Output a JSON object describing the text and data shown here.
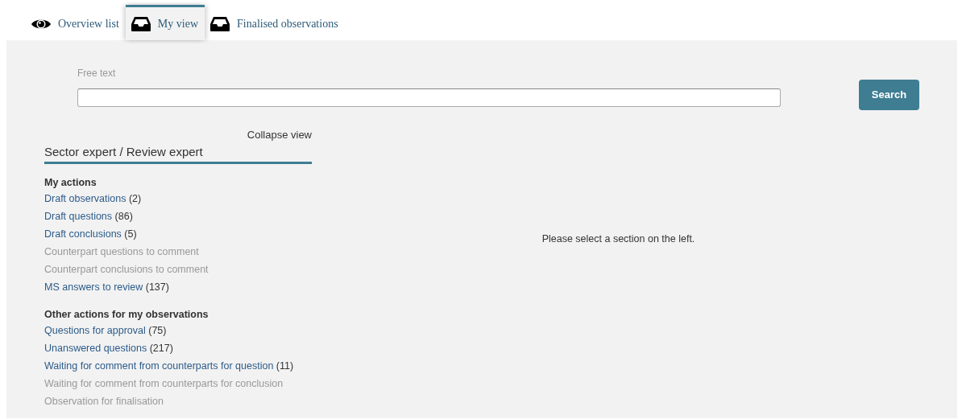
{
  "tabs": [
    {
      "label": "Overview list",
      "kind": "eye",
      "selected": false
    },
    {
      "label": "My view",
      "kind": "tray",
      "selected": true
    },
    {
      "label": "Finalised observations",
      "kind": "tray",
      "selected": false
    }
  ],
  "search": {
    "label": "Free text",
    "button": "Search"
  },
  "sidebar": {
    "collapse": "Collapse view",
    "title": "Sector expert / Review expert",
    "sections": [
      {
        "heading": "My actions",
        "items": [
          {
            "label": "Draft observations",
            "count": "(2)",
            "enabled": true
          },
          {
            "label": "Draft questions",
            "count": "(86)",
            "enabled": true
          },
          {
            "label": "Draft conclusions",
            "count": "(5)",
            "enabled": true
          },
          {
            "label": "Counterpart questions to comment",
            "enabled": false
          },
          {
            "label": "Counterpart conclusions to comment",
            "enabled": false
          },
          {
            "label": "MS answers to review",
            "count": "(137)",
            "enabled": true
          }
        ]
      },
      {
        "heading": "Other actions for my observations",
        "items": [
          {
            "label": "Questions for approval",
            "count": "(75)",
            "enabled": true
          },
          {
            "label": "Unanswered questions",
            "count": "(217)",
            "enabled": true
          },
          {
            "label": "Waiting for comment from counterparts for question",
            "count": "(11)",
            "enabled": true
          },
          {
            "label": "Waiting for comment from counterparts for conclusion",
            "enabled": false
          },
          {
            "label": "Observation for finalisation",
            "enabled": false
          }
        ]
      }
    ]
  },
  "message": "Please select a section on the left."
}
